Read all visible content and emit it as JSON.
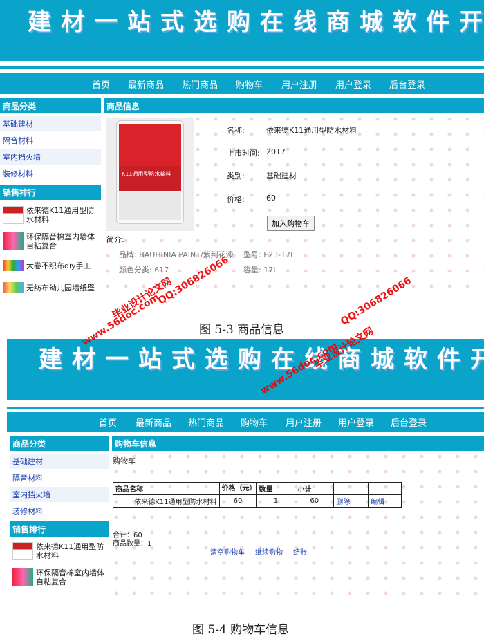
{
  "banner": {
    "title": "建材一站式选购在线商城软件开发"
  },
  "nav": [
    "首页",
    "最新商品",
    "热门商品",
    "购物车",
    "用户注册",
    "用户登录",
    "后台登录"
  ],
  "sidebar": {
    "category_title": "商品分类",
    "categories": [
      "基础建材",
      "隔音材料",
      "室内挡火墙",
      "装修材料"
    ],
    "rank_title": "销售排行",
    "rank_items": [
      "依来德K11通用型防水材料",
      "环保隔音棉室内墙体自粘复合",
      "大卷不织布diy手工",
      "无纺布幼儿园墙纸壁"
    ]
  },
  "product": {
    "panel_title": "商品信息",
    "fields": [
      {
        "label": "名称:",
        "value": "依来德K11通用型防水材料"
      },
      {
        "label": "上市时间:",
        "value": "2017"
      },
      {
        "label": "类别:",
        "value": "基础建材"
      },
      {
        "label": "价格:",
        "value": "60"
      }
    ],
    "add_to_cart": "加入购物车",
    "intro_label": "简介:",
    "intro_brand": "品牌: BAUHINIA PAINT/紫荆花漆",
    "intro_model": "型号: E23-17L",
    "intro_color": "颜色分类: 617",
    "intro_volume": "容量: 17L",
    "bucket_text": "K11通用型防水浆料"
  },
  "caption1": "图 5-3 商品信息",
  "cart": {
    "panel_title": "购物车信息",
    "subtitle": "购物车",
    "headers": [
      "商品名称",
      "价格（元）",
      "数量",
      "小计",
      "",
      ""
    ],
    "row": {
      "name": "依来德K11通用型防水材料",
      "price": "60",
      "qty": "1",
      "subtotal": "60",
      "delete": "删除",
      "edit": "编辑"
    },
    "total": "合计：60",
    "count": "商品数量：1",
    "actions": [
      "清空购物车",
      "继续购物",
      "结账"
    ]
  },
  "caption2": "图 5-4 购物车信息",
  "watermarks": [
    "毕业设计论文网",
    "www.56doc.com",
    "QQ:306826066"
  ]
}
